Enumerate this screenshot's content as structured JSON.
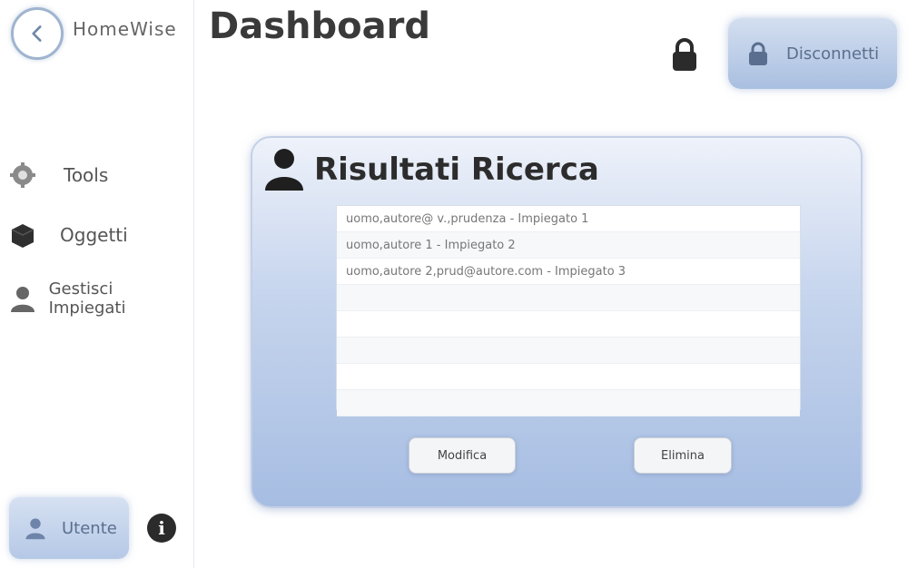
{
  "sidebar": {
    "app_name": "HomeWise",
    "items": [
      {
        "label": "Tools",
        "icon": "gear-icon"
      },
      {
        "label": "Oggetti",
        "icon": "box-icon"
      },
      {
        "label": "Gestisci Impiegati",
        "icon": "person-icon"
      }
    ],
    "user_button": "Utente",
    "info_icon": "i"
  },
  "header": {
    "title": "Dashboard",
    "logout_label": "Disconnetti"
  },
  "results": {
    "title": "Risultati Ricerca",
    "rows": [
      "uomo,autore@ v.,prudenza - Impiegato 1",
      "uomo,autore 1 - Impiegato 2",
      "uomo,autore 2,prud@autore.com - Impiegato 3",
      "",
      "",
      "",
      "",
      ""
    ],
    "modify_label": "Modifica",
    "delete_label": "Elimina"
  },
  "colors": {
    "accent": "#a9bfe0",
    "panel_top": "#eef2fa",
    "panel_bottom": "#a6bde2"
  }
}
